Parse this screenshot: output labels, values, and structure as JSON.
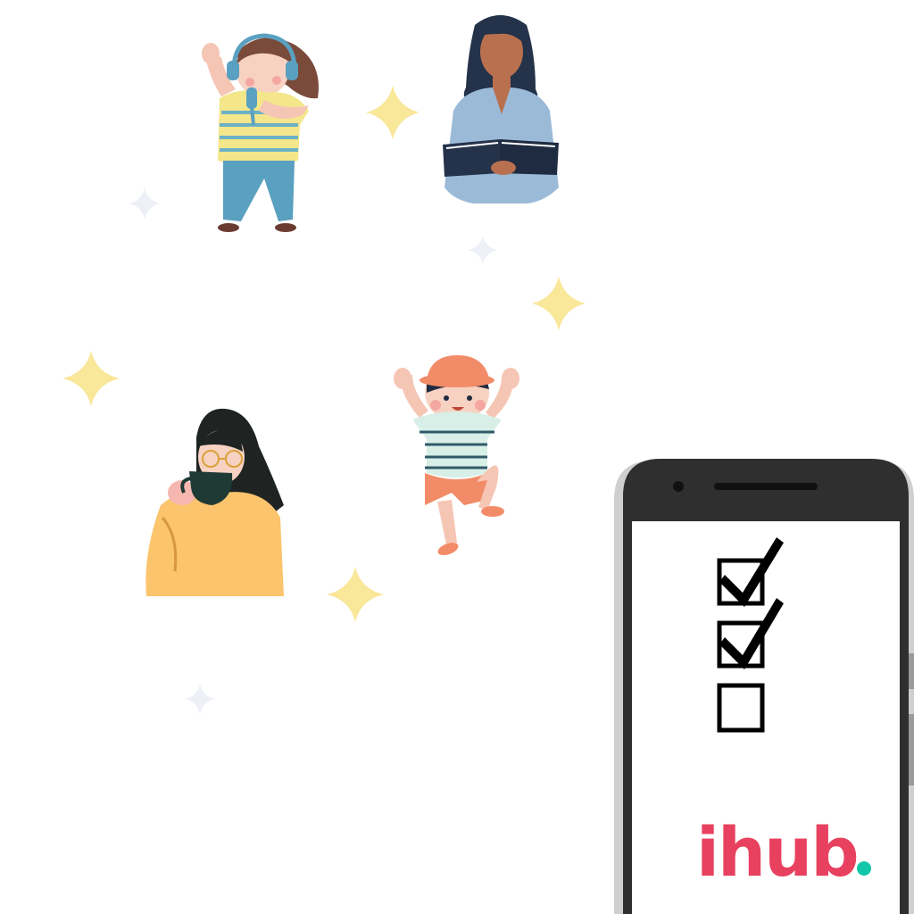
{
  "illustrations": {
    "girl_singer": "girl-with-headphones-singing",
    "woman_reader": "woman-reading-book",
    "boy_dancing": "boy-in-hat-jumping",
    "woman_coffee": "woman-drinking-coffee"
  },
  "phone": {
    "checklist": [
      {
        "checked": true
      },
      {
        "checked": true
      },
      {
        "checked": false
      }
    ],
    "logo": {
      "text": "ihub",
      "dot": ".",
      "text_color": "#e8415f",
      "dot_color": "#12c7a8"
    }
  },
  "colors": {
    "sparkle_yellow": "#f9e79a",
    "sparkle_faint": "#eef0f7",
    "phone_body": "#2f2f2f",
    "phone_shadow": "#cfcfcf"
  }
}
